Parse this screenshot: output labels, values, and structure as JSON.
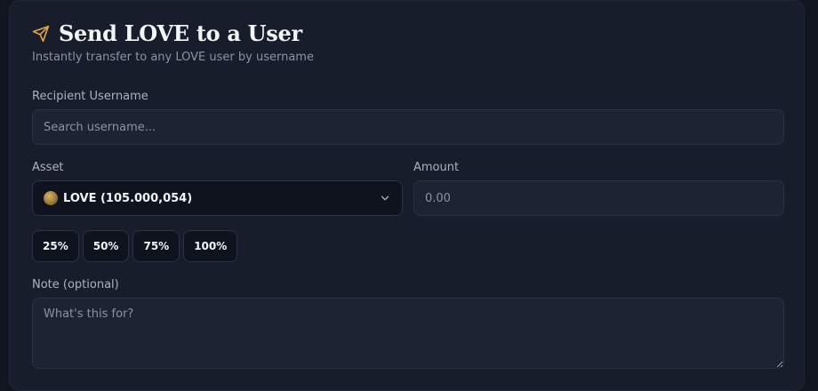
{
  "header": {
    "title": "Send LOVE to a User",
    "subtitle": "Instantly transfer to any LOVE user by username",
    "icon": "send-icon",
    "accent": "#d9a34a"
  },
  "recipient": {
    "label": "Recipient Username",
    "placeholder": "Search username..."
  },
  "asset": {
    "label": "Asset",
    "selected": "LOVE (105.000,054)",
    "icon": "love-coin-icon"
  },
  "amount": {
    "label": "Amount",
    "placeholder": "0.00"
  },
  "percentages": [
    "25%",
    "50%",
    "75%",
    "100%"
  ],
  "note": {
    "label": "Note (optional)",
    "placeholder": "What's this for?"
  }
}
